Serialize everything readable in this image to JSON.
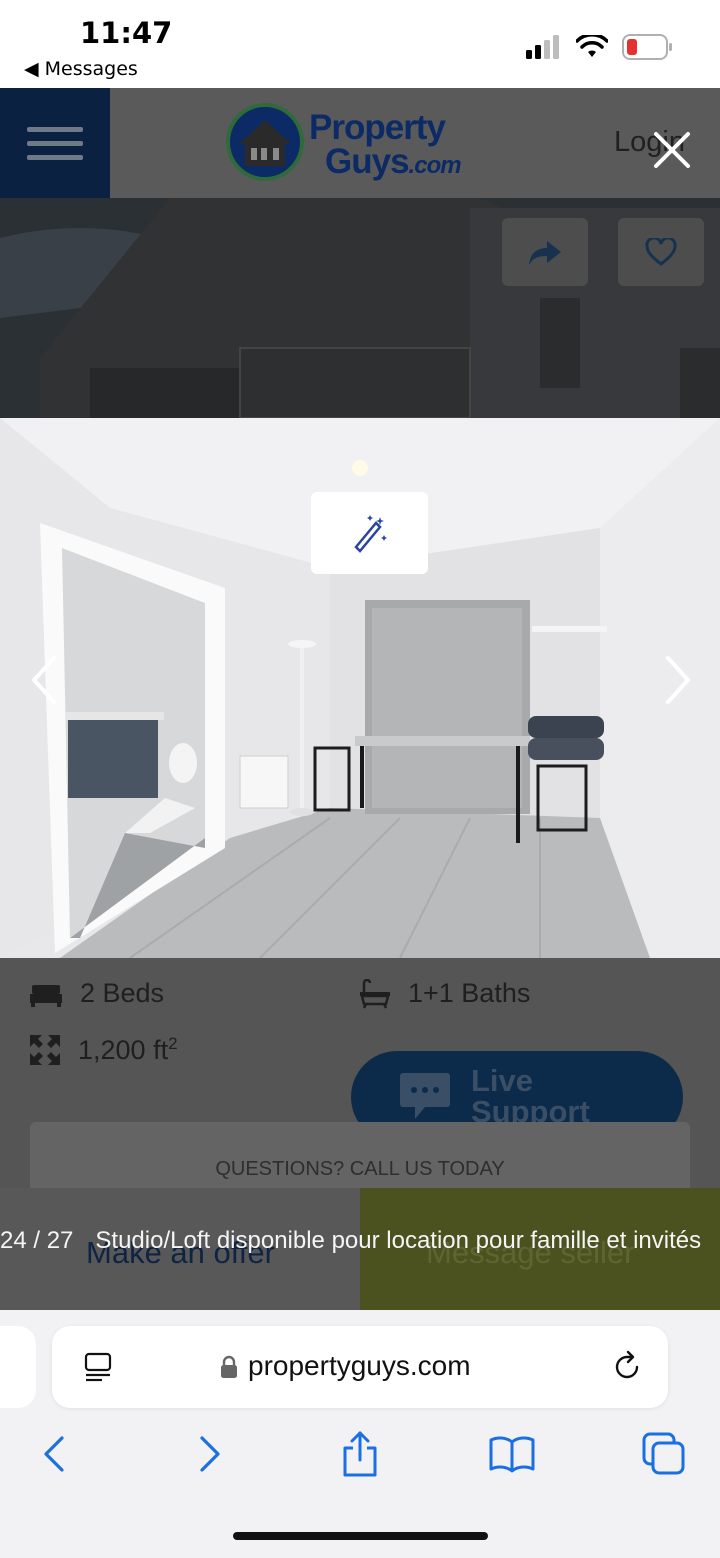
{
  "status_bar": {
    "time": "11:47",
    "back_app": "Messages",
    "battery_color": "#e5312f"
  },
  "header": {
    "logo_line1": "Property",
    "logo_line2": "Guys",
    "logo_suffix": ".com",
    "login_label": "Login",
    "brand_color": "#0b2a66"
  },
  "listing": {
    "beds": "2 Beds",
    "baths": "1+1 Baths",
    "area": "1,200 ft",
    "area_sup": "2",
    "live_support_label": "Live Support",
    "questions_label": "QUESTIONS? CALL US TODAY"
  },
  "actions": {
    "offer_label": "Make an offer",
    "message_label": "Message seller"
  },
  "gallery": {
    "counter": "24 / 27",
    "caption": "Studio/Loft disponible pour location pour famille et invités"
  },
  "browser": {
    "url": "propertyguys.com",
    "accent_color": "#1a6fe3"
  }
}
